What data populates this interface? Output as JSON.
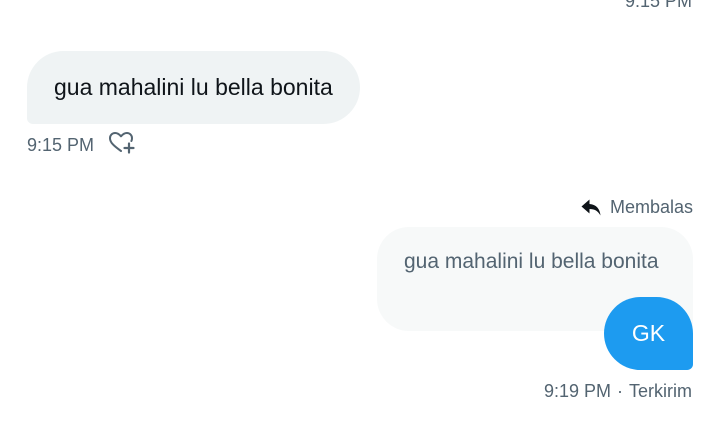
{
  "top_timestamp": "9:15 PM",
  "incoming": {
    "text": "gua mahalini lu bella bonita",
    "timestamp": "9:15 PM",
    "react_icon": "heart-plus-icon"
  },
  "outgoing": {
    "reply_label": "Membalas",
    "reply_icon": "reply-arrow-icon",
    "quoted_text": "gua mahalini lu bella bonita",
    "text": "GK",
    "timestamp": "9:19 PM",
    "separator": "·",
    "status": "Terkirim"
  },
  "colors": {
    "accent": "#1d9bf0",
    "bubble_in": "#eff3f4",
    "quoted_bg": "#f7f9f9",
    "secondary_text": "#536471"
  }
}
